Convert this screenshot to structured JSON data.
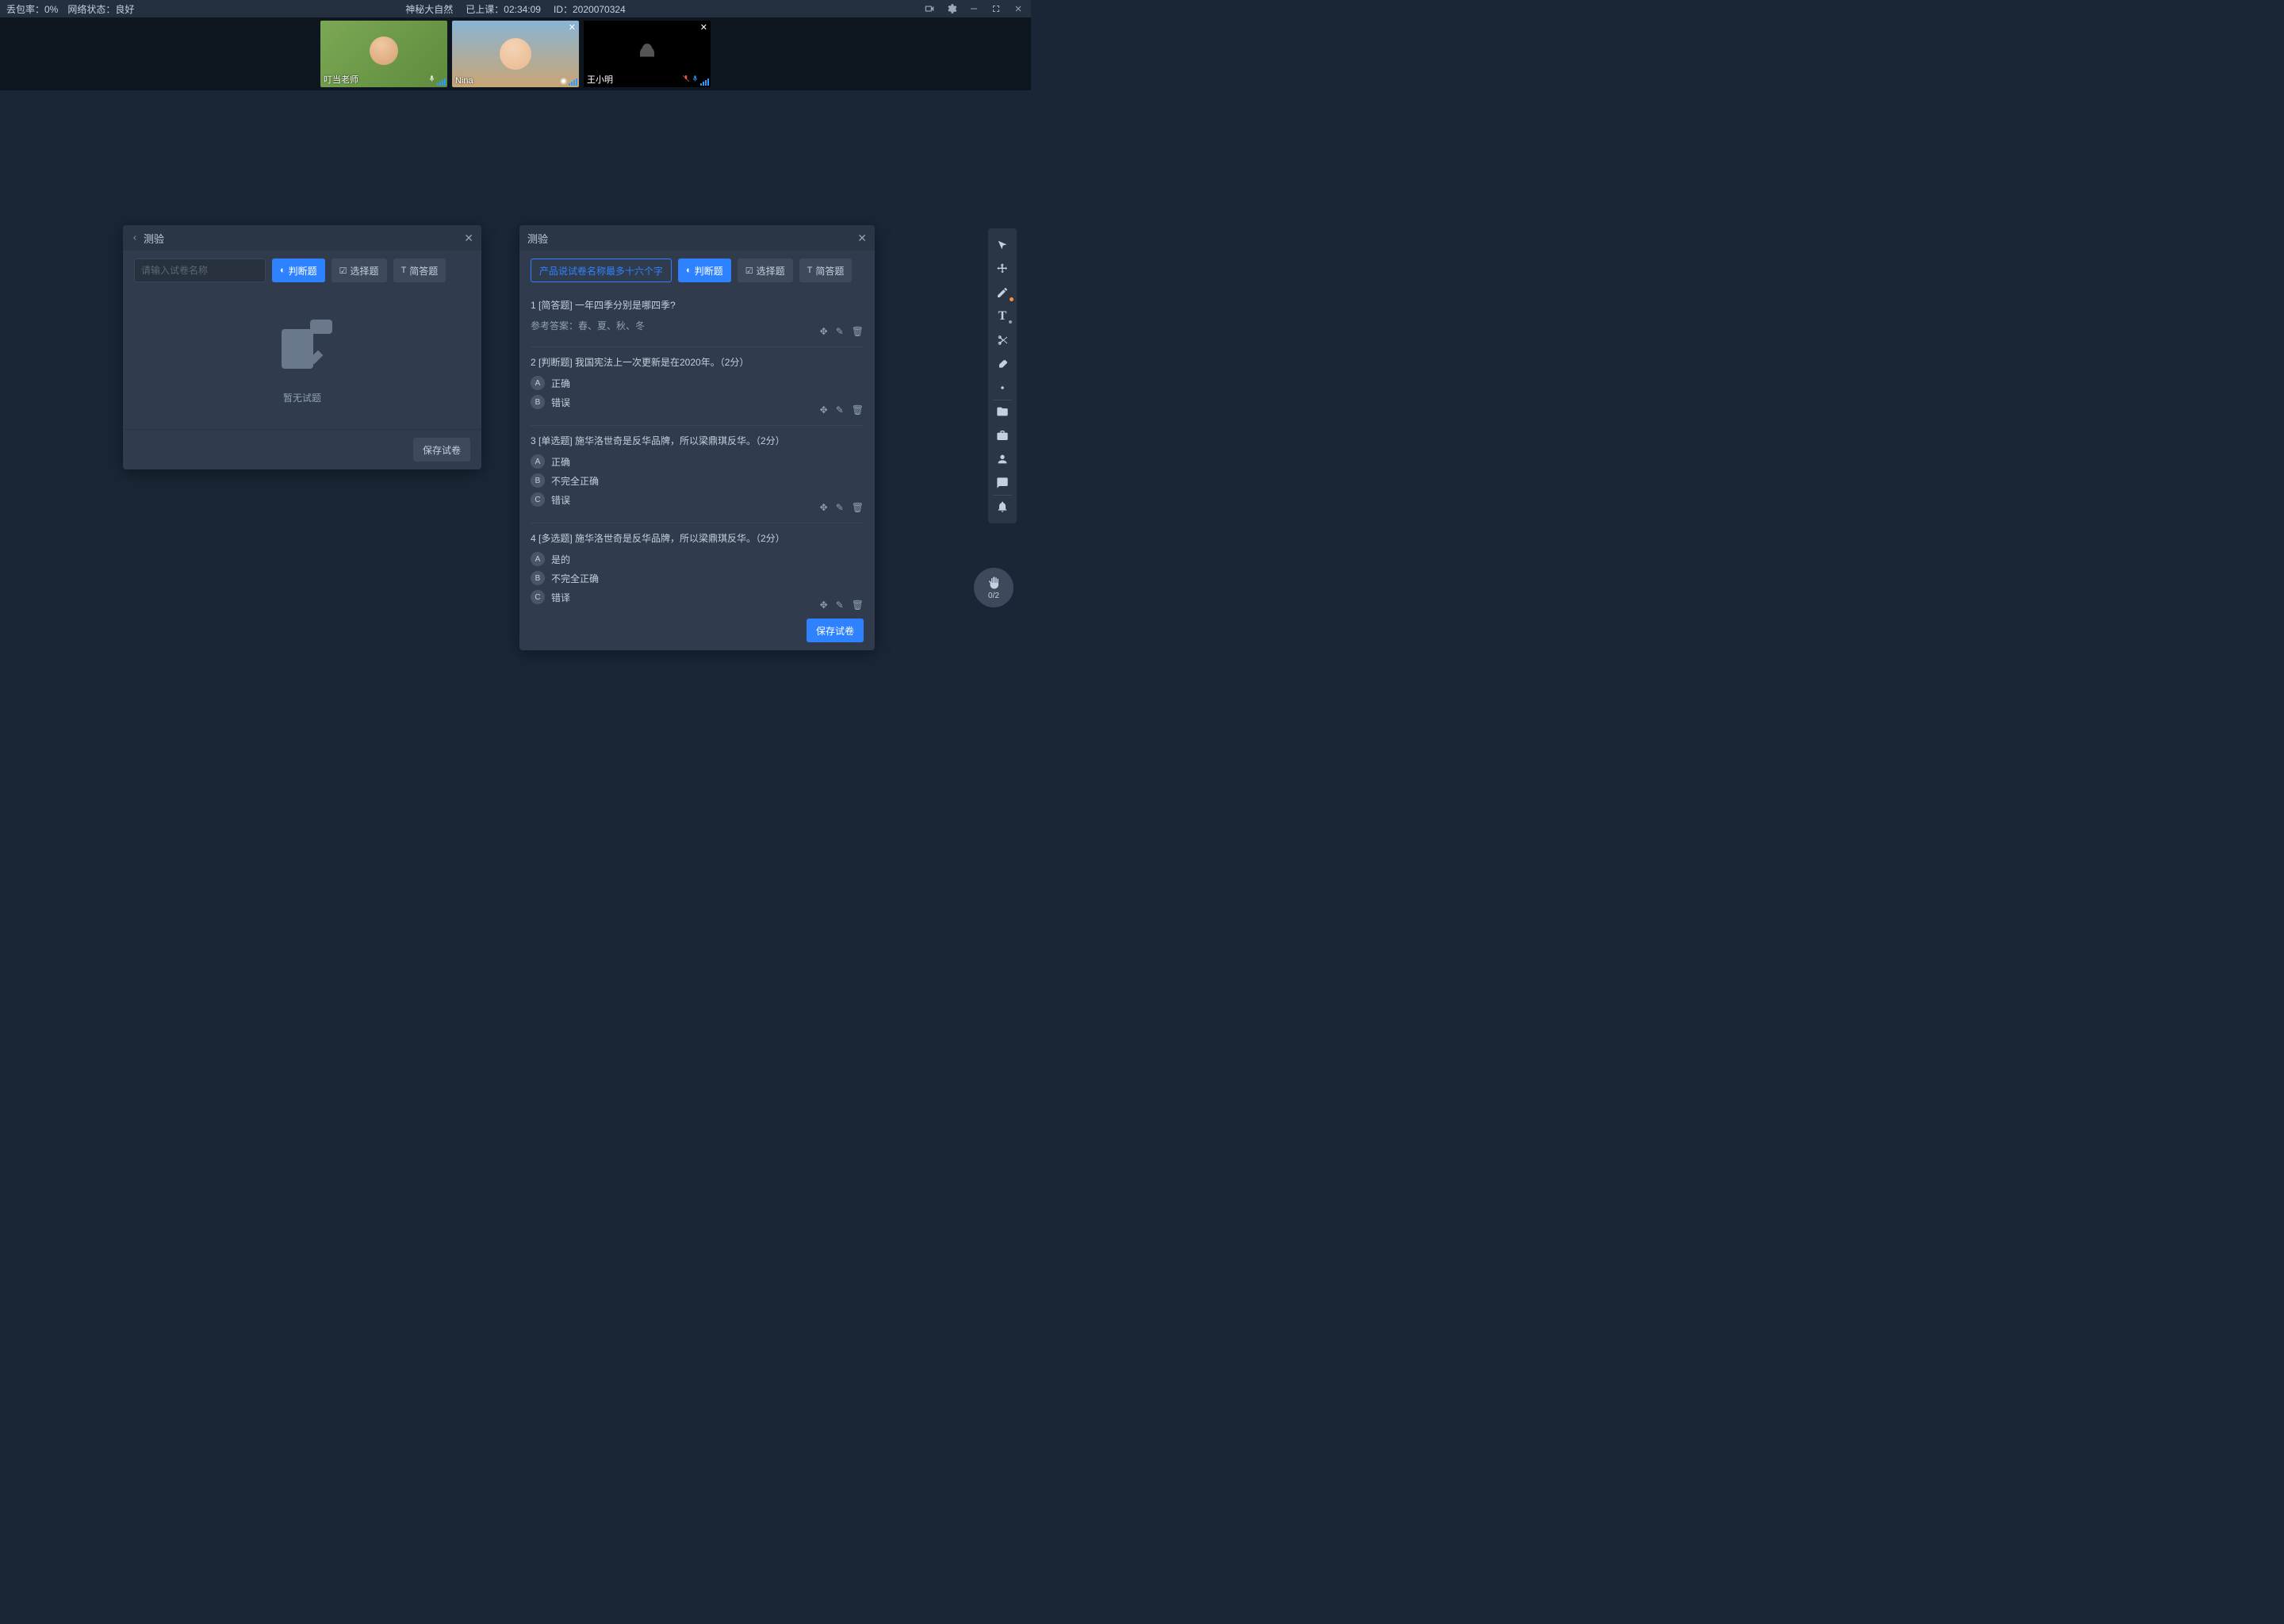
{
  "top": {
    "packet_loss_label": "丢包率：0%",
    "network_label": "网络状态：良好",
    "title": "神秘大自然",
    "class_time_label": "已上课：02:34:09",
    "id_label": "ID：2020070324"
  },
  "videos": [
    {
      "name": "叮当老师",
      "closeable": false,
      "bg": "green",
      "mic_muted": false
    },
    {
      "name": "Nina",
      "closeable": true,
      "bg": "beach",
      "mic_muted": false
    },
    {
      "name": "王小明",
      "closeable": true,
      "bg": "black",
      "mic_muted": true
    }
  ],
  "panelLeft": {
    "title": "测验",
    "input_placeholder": "请输入试卷名称",
    "btn_judge": "判断题",
    "btn_select": "选择题",
    "btn_short": "简答题",
    "empty": "暂无试题",
    "save": "保存试卷"
  },
  "panelRight": {
    "title": "测验",
    "name_value": "产品说试卷名称最多十六个字",
    "btn_judge": "判断题",
    "btn_select": "选择题",
    "btn_short": "简答题",
    "save": "保存试卷",
    "questions": [
      {
        "title": "1 [简答题] 一年四季分别是哪四季?",
        "answer_label": "参考答案：春、夏、秋、冬",
        "options": null
      },
      {
        "title": "2 [判断题] 我国宪法上一次更新是在2020年。（2分）",
        "options": [
          {
            "badge": "A",
            "text": "正确"
          },
          {
            "badge": "B",
            "text": "错误"
          }
        ]
      },
      {
        "title": "3 [单选题] 施华洛世奇是反华品牌，所以梁鼎琪反华。（2分）",
        "options": [
          {
            "badge": "A",
            "text": "正确"
          },
          {
            "badge": "B",
            "text": "不完全正确"
          },
          {
            "badge": "C",
            "text": "错误"
          }
        ]
      },
      {
        "title": "4 [多选题] 施华洛世奇是反华品牌，所以梁鼎琪反华。（2分）",
        "options": [
          {
            "badge": "A",
            "text": "是的"
          },
          {
            "badge": "B",
            "text": "不完全正确"
          },
          {
            "badge": "C",
            "text": "错译"
          }
        ]
      }
    ]
  },
  "hand": {
    "count": "0/2"
  }
}
